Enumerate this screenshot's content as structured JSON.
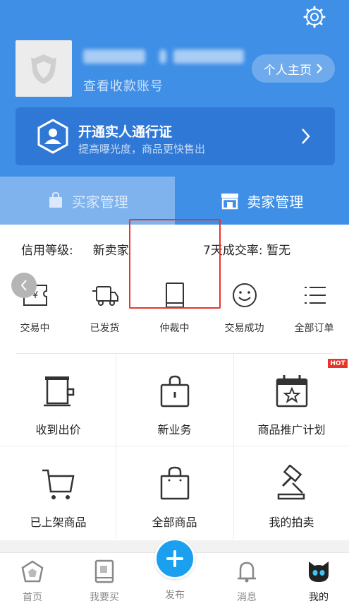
{
  "header": {
    "view_account_label": "查看收款账号",
    "profile_button_label": "个人主页",
    "promo": {
      "title": "开通实人通行证",
      "subtitle": "提高曝光度，商品更快售出"
    }
  },
  "tabs": [
    {
      "label": "买家管理",
      "active": false
    },
    {
      "label": "卖家管理",
      "active": true
    }
  ],
  "credit": {
    "level_label": "信用等级:",
    "level_value": "新卖家",
    "rate_label": "7天成交率:",
    "rate_value": "暂无"
  },
  "orders": [
    {
      "label": "交易中",
      "icon": "yen-tag-icon"
    },
    {
      "label": "已发货",
      "icon": "truck-icon"
    },
    {
      "label": "仲裁中",
      "icon": "book-icon"
    },
    {
      "label": "交易成功",
      "icon": "smile-icon"
    },
    {
      "label": "全部订单",
      "icon": "list-icon"
    }
  ],
  "services": [
    {
      "label": "收到出价",
      "icon": "bid-cup-icon"
    },
    {
      "label": "新业务",
      "icon": "lock-bag-icon"
    },
    {
      "label": "商品推广计划",
      "icon": "calendar-star-icon",
      "badge": "HOT"
    },
    {
      "label": "已上架商品",
      "icon": "cart-icon"
    },
    {
      "label": "全部商品",
      "icon": "shopping-bag-icon"
    },
    {
      "label": "我的拍卖",
      "icon": "gavel-icon"
    }
  ],
  "bottom_nav": [
    {
      "label": "首页",
      "icon": "home-icon"
    },
    {
      "label": "我要买",
      "icon": "buy-book-icon"
    },
    {
      "label": "发布",
      "icon": "plus-icon"
    },
    {
      "label": "消息",
      "icon": "bell-icon"
    },
    {
      "label": "我的",
      "icon": "cat-icon",
      "active": true
    }
  ],
  "colors": {
    "primary": "#3f8fe6",
    "promo_bg": "#2f78d6",
    "publish": "#1aa0ee",
    "hot": "#e8352c",
    "highlight": "#e8352c"
  }
}
